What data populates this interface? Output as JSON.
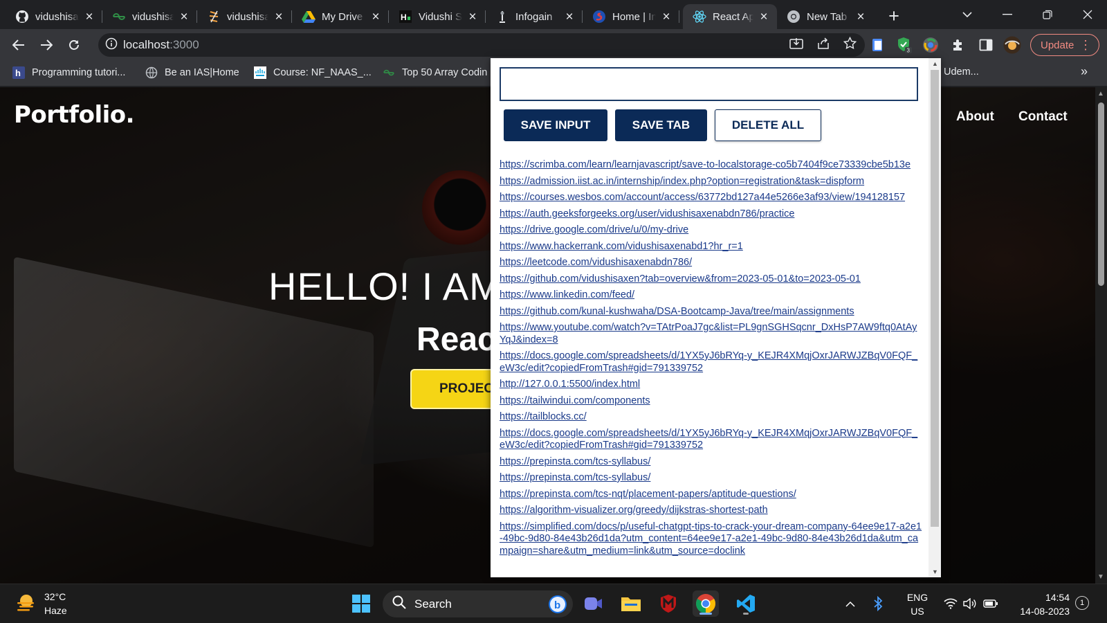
{
  "browser": {
    "tabs": [
      {
        "title": "vidushisaxen",
        "icon": "github-icon"
      },
      {
        "title": "vidushisaxen",
        "icon": "geeksforgeeks-icon"
      },
      {
        "title": "vidushisaxen",
        "icon": "hackerrank-icon"
      },
      {
        "title": "My Drive",
        "icon": "google-drive-icon"
      },
      {
        "title": "Vidushi Saxena",
        "icon": "hackerearth-icon"
      },
      {
        "title": "Infogain",
        "icon": "infogain-icon"
      },
      {
        "title": "Home | Infogain",
        "icon": "home-site-icon"
      },
      {
        "title": "React App",
        "icon": "react-icon"
      },
      {
        "title": "New Tab",
        "icon": "chrome-icon"
      }
    ],
    "active_tab_index": 7,
    "url_host": "localhost",
    "url_port": ":3000",
    "extension_badge": "3",
    "update_label": "Update",
    "bookmarks": [
      {
        "label": "Programming tutori...",
        "icon": "bookmark-h-icon"
      },
      {
        "label": "Be an IAS|Home",
        "icon": "globe-icon"
      },
      {
        "label": "Course: NF_NAAS_...",
        "icon": "cisco-icon"
      },
      {
        "label": "Top 50 Array Codin",
        "icon": "geeksforgeeks-icon"
      },
      {
        "label": "Udem...",
        "icon": "udemy-icon"
      }
    ],
    "bookmarks_overflow": "»"
  },
  "site": {
    "logo": "Portfolio.",
    "nav": [
      "About",
      "Contact"
    ],
    "hero_line1": "HELLO! I AM",
    "hero_line2": "Reac",
    "hero_button": "PROJEC"
  },
  "popup": {
    "input_value": "",
    "buttons": {
      "save_input": "SAVE INPUT",
      "save_tab": "SAVE TAB",
      "delete_all": "DELETE ALL"
    },
    "links": [
      "https://scrimba.com/learn/learnjavascript/save-to-localstorage-co5b7404f9ce73339cbe5b13e",
      "https://admission.iist.ac.in/internship/index.php?option=registration&task=dispform",
      "https://courses.wesbos.com/account/access/63772bd127a44e5266e3af93/view/194128157",
      "https://auth.geeksforgeeks.org/user/vidushisaxenabdn786/practice",
      "https://drive.google.com/drive/u/0/my-drive",
      "https://www.hackerrank.com/vidushisaxenabd1?hr_r=1",
      "https://leetcode.com/vidushisaxenabdn786/",
      "https://github.com/vidushisaxen?tab=overview&from=2023-05-01&to=2023-05-01",
      "https://www.linkedin.com/feed/",
      "https://github.com/kunal-kushwaha/DSA-Bootcamp-Java/tree/main/assignments",
      "https://www.youtube.com/watch?v=TAtrPoaJ7gc&list=PL9gnSGHSqcnr_DxHsP7AW9ftq0AtAyYqJ&index=8",
      "https://docs.google.com/spreadsheets/d/1YX5yJ6bRYq-y_KEJR4XMqjOxrJARWJZBqV0FQF_eW3c/edit?copiedFromTrash#gid=791339752",
      "http://127.0.0.1:5500/index.html",
      "https://tailwindui.com/components",
      "https://tailblocks.cc/",
      "https://docs.google.com/spreadsheets/d/1YX5yJ6bRYq-y_KEJR4XMqjOxrJARWJZBqV0FQF_eW3c/edit?copiedFromTrash#gid=791339752",
      "https://prepinsta.com/tcs-syllabus/",
      "https://prepinsta.com/tcs-syllabus/",
      "https://prepinsta.com/tcs-nqt/placement-papers/aptitude-questions/",
      "https://algorithm-visualizer.org/greedy/dijkstras-shortest-path",
      "https://simplified.com/docs/p/useful-chatgpt-tips-to-crack-your-dream-company-64ee9e17-a2e1-49bc-9d80-84e43b26d1da?utm_content=64ee9e17-a2e1-49bc-9d80-84e43b26d1da&utm_campaign=share&utm_medium=link&utm_source=doclink"
    ]
  },
  "taskbar": {
    "temperature": "32°C",
    "weather": "Haze",
    "search_label": "Search",
    "lang": "ENG",
    "region": "US",
    "time": "14:54",
    "date": "14-08-2023",
    "notification_count": "1"
  },
  "colors": {
    "popup_button_navy": "#0b2a57",
    "link_blue": "#1a3a8a",
    "hero_button_yellow": "#f5d515",
    "update_red": "#f28b82"
  }
}
